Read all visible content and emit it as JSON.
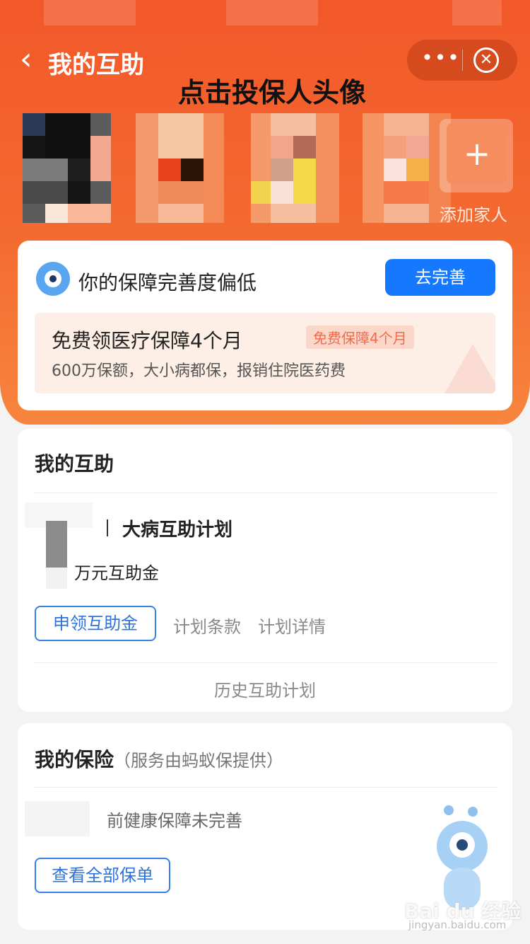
{
  "header": {
    "back_glyph": "‹",
    "title": "我的互助",
    "more_glyph": "•••",
    "close_glyph": "✕"
  },
  "hint": "点击投保人头像",
  "add_family": {
    "plus": "+",
    "label": "添加家人"
  },
  "completeness_card": {
    "text": "你的保障完善度偏低",
    "button": "去完善",
    "promo": {
      "title": "免费领医疗保障4个月",
      "badge": "免费保障4个月",
      "subtitle": "600万保额，大小病都保，报销住院医药费"
    }
  },
  "mutual_card": {
    "title": "我的互助",
    "plan_name": "大病互助计划",
    "amount_text": "万元互助金",
    "claim_button": "申领互助金",
    "terms_link": "计划条款",
    "details_link": "计划详情",
    "history_link": "历史互助计划"
  },
  "insurance_card": {
    "title": "我的保险",
    "provider": "（服务由蚂蚁保提供）",
    "status_text": "前健康保障未完善",
    "view_all_button": "查看全部保单"
  },
  "watermark": {
    "logo": "Bai du 经验",
    "url": "jingyan.baidu.com"
  },
  "colors": {
    "header_orange": "#f2582a",
    "primary_blue": "#1677ff",
    "link_blue": "#2f73d8"
  }
}
